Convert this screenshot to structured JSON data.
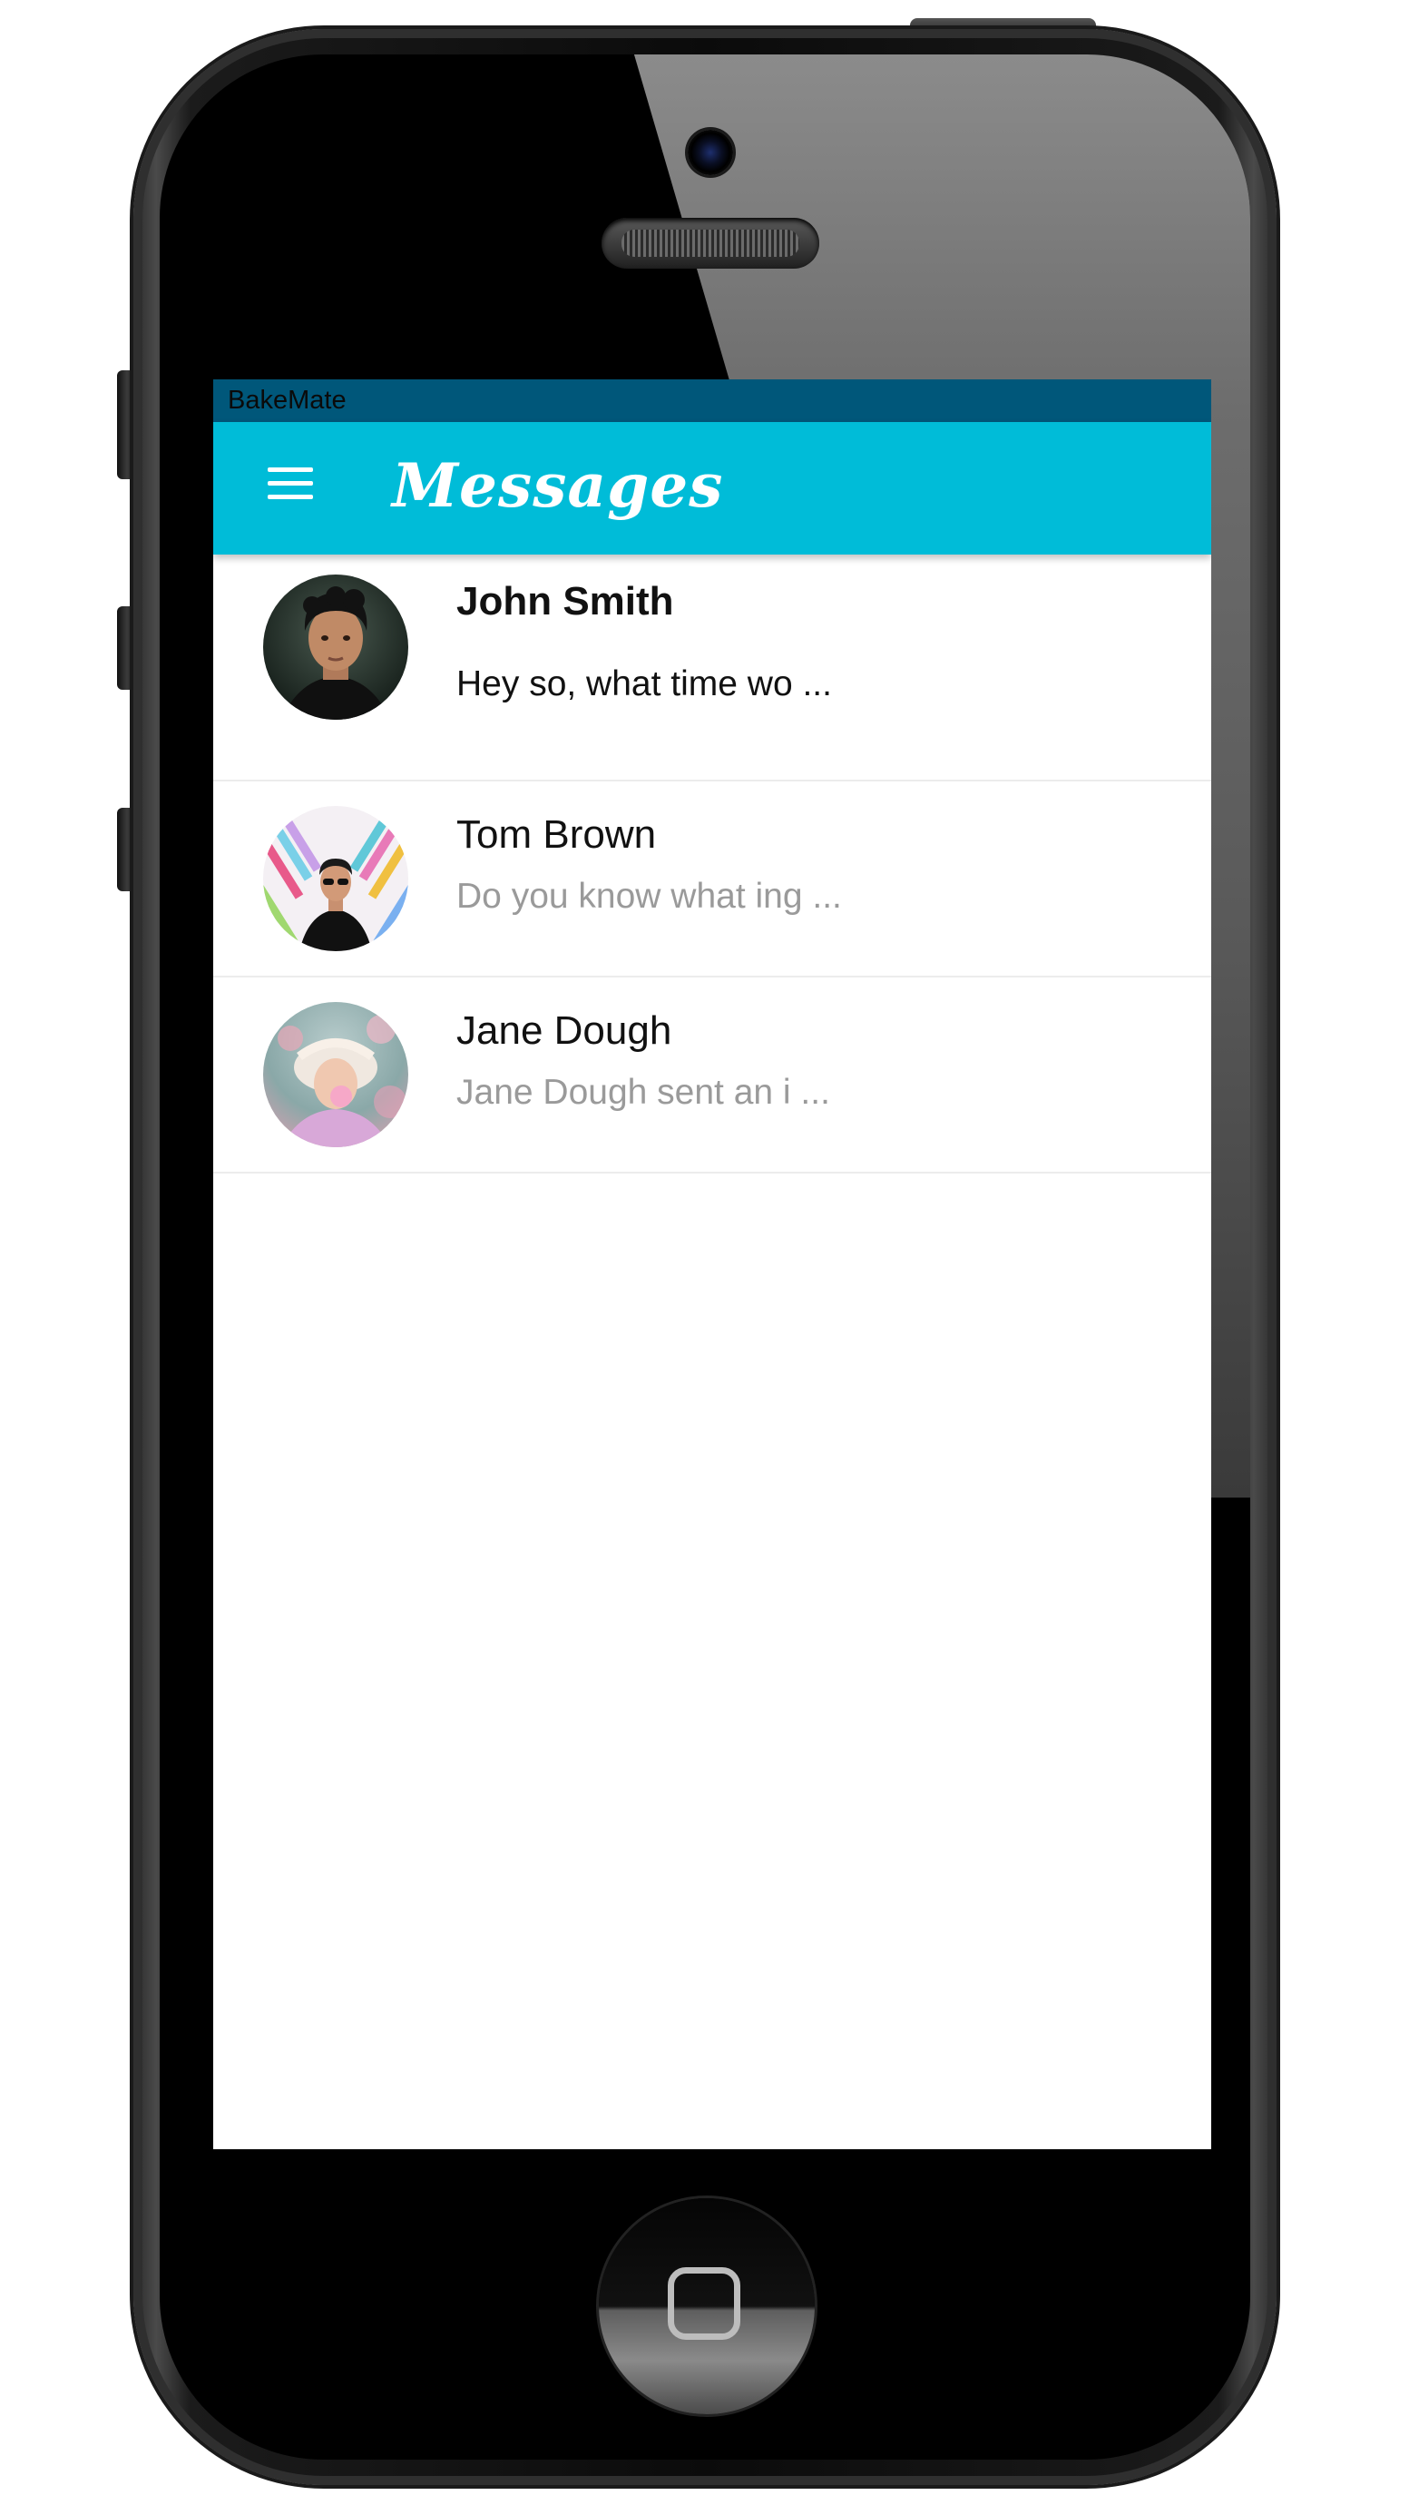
{
  "status_bar": {
    "app_name": "BakeMate",
    "color": "#00577a"
  },
  "app_bar": {
    "title": "Messages",
    "menu_icon": "hamburger-menu-icon",
    "color": "#00bcd8"
  },
  "conversations": [
    {
      "name": "John Smith",
      "preview": "Hey so, what time wo ...",
      "unread": true,
      "avatar_icon": "avatar-john-smith"
    },
    {
      "name": "Tom Brown",
      "preview": "Do you know what ing ...",
      "unread": false,
      "avatar_icon": "avatar-tom-brown"
    },
    {
      "name": "Jane Dough",
      "preview": "Jane Dough sent an i ...",
      "unread": false,
      "avatar_icon": "avatar-jane-dough"
    }
  ],
  "device": {
    "home_button_icon": "home-button-icon",
    "camera_icon": "front-camera-icon",
    "speaker_icon": "earpiece-speaker-icon"
  }
}
